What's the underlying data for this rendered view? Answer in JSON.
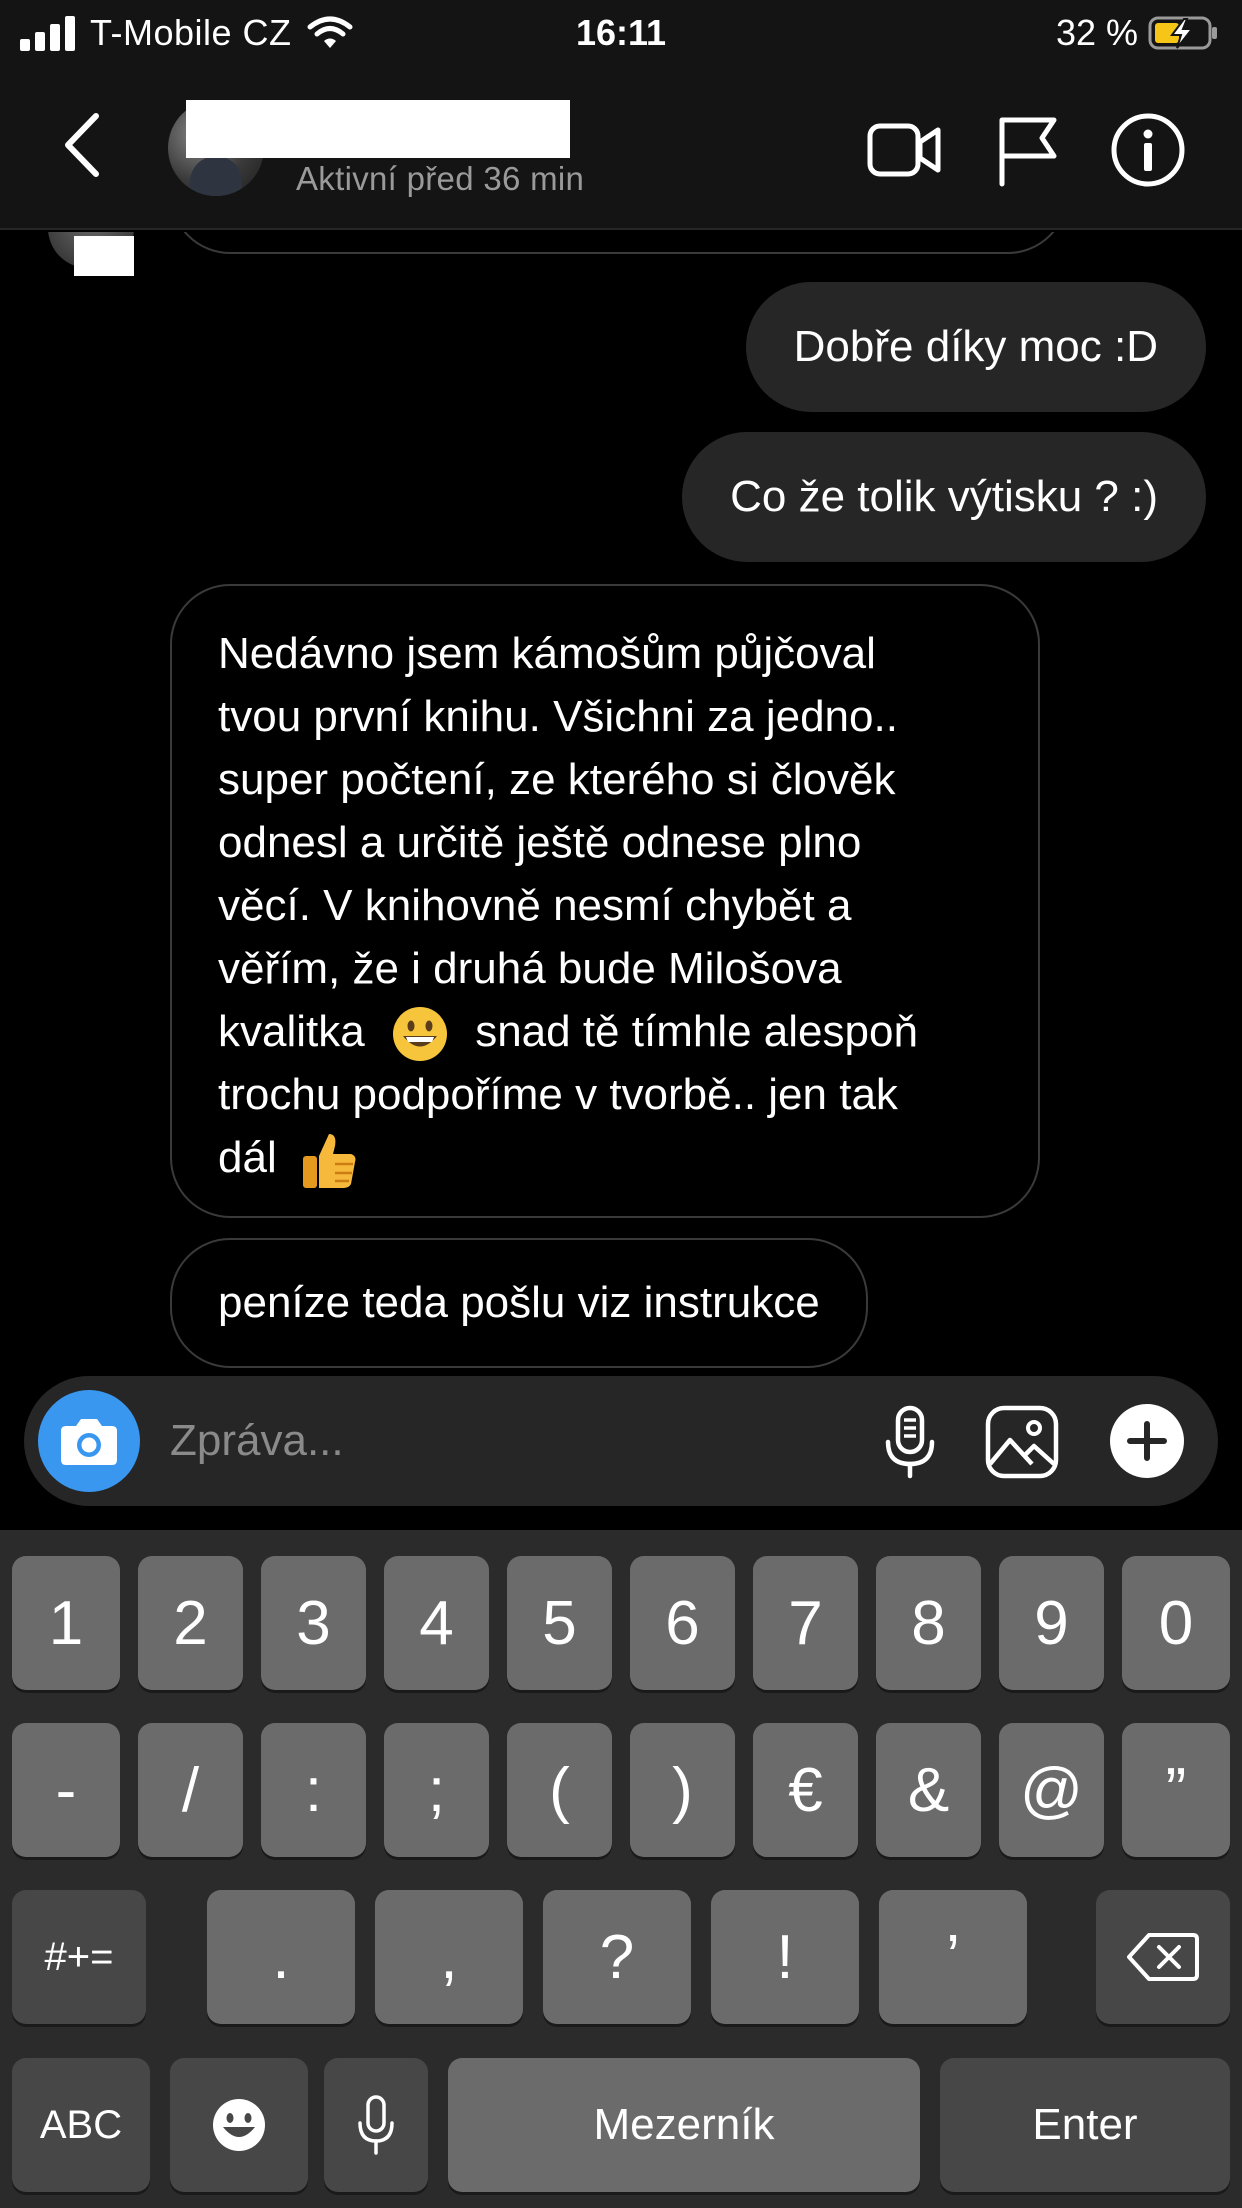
{
  "status_bar": {
    "carrier": "T-Mobile CZ",
    "time": "16:11",
    "battery": "32 %"
  },
  "header": {
    "status": "Aktivní před 36 min"
  },
  "messages": [
    {
      "direction": "outgoing",
      "text": "Dobře díky moc :D"
    },
    {
      "direction": "outgoing",
      "text": "Co že tolik výtisku ? :)"
    },
    {
      "direction": "incoming",
      "lines": [
        "Nedávno jsem kámošům půjčoval",
        "tvou první knihu. Všichni za jedno..",
        "super počtení, ze kterého si člověk",
        "odnesl a určitě ještě odnese plno",
        "věcí. V knihovně nesmí chybět a",
        "věřím, že i druhá bude Milošova",
        "kvalitka",
        "snad tě tímhle alespoň",
        "trochu podpoříme v tvorbě.. jen tak",
        "dál"
      ]
    },
    {
      "direction": "incoming",
      "text": "peníze teda pošlu viz instrukce"
    }
  ],
  "composer": {
    "placeholder": "Zpráva..."
  },
  "keyboard": {
    "row1": [
      "1",
      "2",
      "3",
      "4",
      "5",
      "6",
      "7",
      "8",
      "9",
      "0"
    ],
    "row2": [
      "-",
      "/",
      ":",
      ";",
      "(",
      ")",
      "€",
      "&",
      "@",
      "”"
    ],
    "row3": {
      "shift": "#+=",
      "keys": [
        ".",
        ",",
        "?",
        "!",
        "’"
      ]
    },
    "row4": {
      "abc": "ABC",
      "space": "Mezerník",
      "enter": "Enter"
    }
  },
  "icons": {
    "back": "chevron-left-icon",
    "video": "video-camera-icon",
    "flag": "flag-icon",
    "info": "info-icon",
    "camera": "camera-icon",
    "mic": "microphone-icon",
    "gallery": "image-icon",
    "plus": "plus-icon",
    "emoji": "emoji-icon",
    "dictation": "microphone-icon",
    "backspace": "backspace-icon"
  },
  "colors": {
    "background": "#000000",
    "bar": "#141414",
    "outgoing_bubble": "#262626",
    "camera_button": "#3a97f0",
    "key": "#6b6b6b",
    "key_dark": "#474747"
  }
}
